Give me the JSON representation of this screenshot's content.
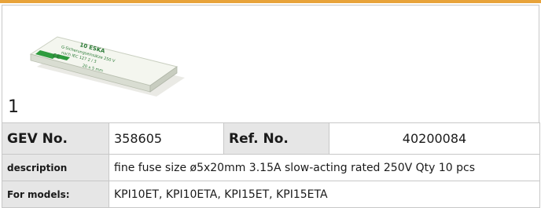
{
  "image": {
    "item_number": "1",
    "fuse_box": {
      "line1": "10 ESKA",
      "line2": "G-Sicherungseinsätze  250 V",
      "line3": "nach IEC 127   2 / 3",
      "line4": "20 x 5 mm",
      "ce_mark": "CE"
    }
  },
  "spec": {
    "gev_label": "GEV No.",
    "gev_value": "358605",
    "ref_label": "Ref. No.",
    "ref_value": "40200084",
    "description_label": "description",
    "description_value": "fine fuse  size ø5x20mm 3.15A slow-acting rated 250V Qty 10 pcs",
    "models_label": "For models:",
    "models_value": "KPI10ET, KPI10ETA, KPI15ET, KPI15ETA"
  },
  "colors": {
    "accent_bar": "#e8a33a",
    "label_background": "#e6e6e6",
    "border": "#c8c8c8"
  }
}
